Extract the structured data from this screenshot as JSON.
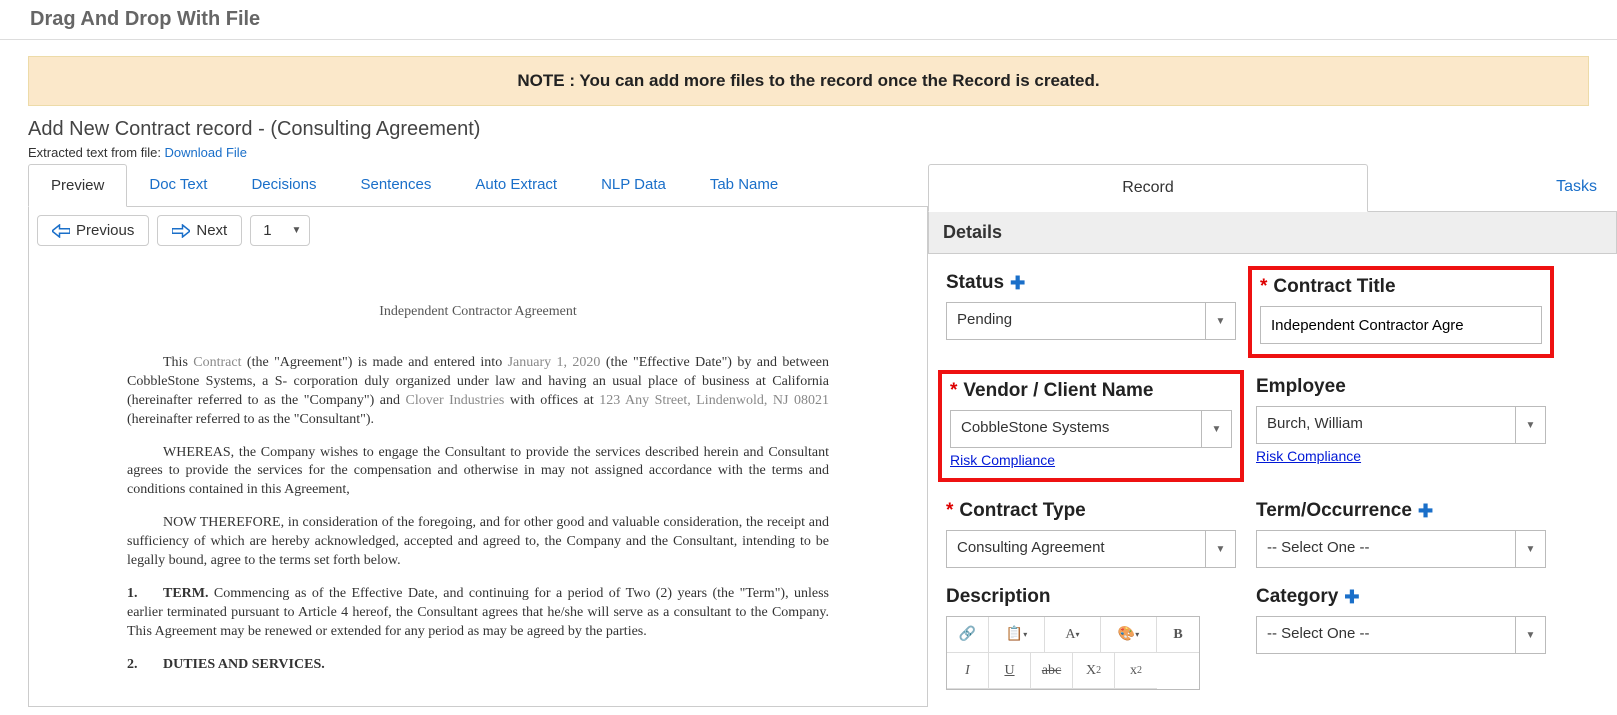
{
  "page_title": "Drag And Drop With File",
  "note_banner": "NOTE : You can add more files to the record once the Record is created.",
  "subtitle": "Add New Contract record - (Consulting Agreement)",
  "extracted_prefix": "Extracted text from file: ",
  "download_link": "Download File",
  "left_tabs": {
    "preview": "Preview",
    "doc_text": "Doc Text",
    "decisions": "Decisions",
    "sentences": "Sentences",
    "auto_extract": "Auto Extract",
    "nlp_data": "NLP Data",
    "tab_name": "Tab Name"
  },
  "pager": {
    "previous": "Previous",
    "next": "Next",
    "page": "1"
  },
  "document": {
    "title": "Independent Contractor Agreement",
    "p1_a": "This ",
    "p1_contract": "Contract",
    "p1_b": " (the \"Agreement\") is made and entered into ",
    "p1_date": "January 1, 2020",
    "p1_c": " (the \"Effective Date\") by and between CobbleStone Systems, a S- corporation duly organized under law and having an usual place of business at  California (hereinafter referred to as the \"Company\") and ",
    "p1_clover": "Clover Industries",
    "p1_d": " with offices at ",
    "p1_addr": "123 Any Street, Lindenwold, NJ 08021",
    "p1_e": " (hereinafter referred to as the \"Consultant\").",
    "p2": "WHEREAS, the Company wishes to engage the Consultant to provide the services described herein and Consultant agrees to provide the services for the compensation and otherwise in may not assigned accordance with the terms and conditions contained in this Agreement,",
    "p3": "NOW THEREFORE, in consideration of the foregoing, and for other good and valuable consideration, the receipt and sufficiency of which are hereby acknowledged, accepted and agreed to, the Company and the Consultant, intending to be legally bound, agree to the terms set forth below.",
    "n1_num": "1.",
    "n1_head": "TERM.",
    "n1_body": "  Commencing as of the Effective Date, and continuing for a period of Two (2) years (the \"Term\"), unless earlier terminated pursuant to Article 4 hereof, the Consultant agrees that he/she will serve as a consultant to the Company.  This Agreement may be renewed or extended for any period as may be agreed by the parties.",
    "n2_num": "2.",
    "n2_head": "DUTIES AND SERVICES."
  },
  "right_tabs": {
    "record": "Record",
    "tasks": "Tasks"
  },
  "details_header": "Details",
  "form": {
    "status_label": "Status",
    "status_value": "Pending",
    "contract_title_label": "Contract Title",
    "contract_title_value": "Independent Contractor Agre",
    "vendor_label": "Vendor / Client Name",
    "vendor_value": "CobbleStone Systems",
    "employee_label": "Employee",
    "employee_value": "Burch, William",
    "risk_link": "Risk Compliance",
    "contract_type_label": "Contract Type",
    "contract_type_value": "Consulting Agreement",
    "term_label": "Term/Occurrence",
    "term_value": "-- Select One --",
    "description_label": "Description",
    "category_label": "Category",
    "category_value": "-- Select One --"
  },
  "rte": {
    "bold": "B",
    "italic": "I",
    "underline": "U",
    "strike": "abc",
    "font_letter": "A",
    "sub_x": "X",
    "sub_2": "2",
    "sup_x": "x",
    "sup_2": "2"
  }
}
